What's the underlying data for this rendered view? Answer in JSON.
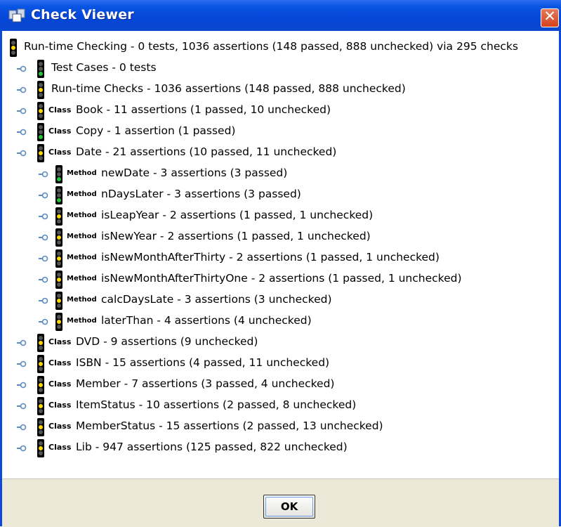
{
  "window": {
    "title": "Check Viewer",
    "close_symbol": "✕"
  },
  "tree": {
    "nodes": [
      {
        "label": "Run-time Checking - 0 tests, 1036 assertions (148 passed, 888 unchecked) via 295 checks",
        "kind": "",
        "status": "yellow",
        "level": 0
      },
      {
        "label": "Test Cases - 0 tests",
        "kind": "",
        "status": "green",
        "level": 1
      },
      {
        "label": "Run-time Checks - 1036 assertions (148 passed, 888 unchecked)",
        "kind": "",
        "status": "yellow",
        "level": 1
      },
      {
        "label": "Book - 11 assertions (1 passed, 10 unchecked)",
        "kind": "Class",
        "status": "yellow",
        "level": 2
      },
      {
        "label": "Copy - 1 assertion (1 passed)",
        "kind": "Class",
        "status": "green",
        "level": 2
      },
      {
        "label": "Date - 21 assertions (10 passed, 11 unchecked)",
        "kind": "Class",
        "status": "yellow",
        "level": 2
      },
      {
        "label": "newDate - 3 assertions (3 passed)",
        "kind": "Method",
        "status": "green",
        "level": 3
      },
      {
        "label": "nDaysLater - 3 assertions (3 passed)",
        "kind": "Method",
        "status": "green",
        "level": 3
      },
      {
        "label": "isLeapYear - 2 assertions (1 passed, 1 unchecked)",
        "kind": "Method",
        "status": "yellow",
        "level": 3
      },
      {
        "label": "isNewYear - 2 assertions (1 passed, 1 unchecked)",
        "kind": "Method",
        "status": "yellow",
        "level": 3
      },
      {
        "label": "isNewMonthAfterThirty - 2 assertions (1 passed, 1 unchecked)",
        "kind": "Method",
        "status": "yellow",
        "level": 3
      },
      {
        "label": "isNewMonthAfterThirtyOne - 2 assertions (1 passed, 1 unchecked)",
        "kind": "Method",
        "status": "yellow",
        "level": 3
      },
      {
        "label": "calcDaysLate - 3 assertions (3 unchecked)",
        "kind": "Method",
        "status": "yellow",
        "level": 3
      },
      {
        "label": "laterThan - 4 assertions (4 unchecked)",
        "kind": "Method",
        "status": "yellow",
        "level": 3
      },
      {
        "label": "DVD - 9 assertions (9 unchecked)",
        "kind": "Class",
        "status": "yellow",
        "level": 2
      },
      {
        "label": "ISBN - 15 assertions (4 passed, 11 unchecked)",
        "kind": "Class",
        "status": "yellow",
        "level": 2
      },
      {
        "label": "Member - 7 assertions (3 passed, 4 unchecked)",
        "kind": "Class",
        "status": "yellow",
        "level": 2
      },
      {
        "label": "ItemStatus - 10 assertions (2 passed, 8 unchecked)",
        "kind": "Class",
        "status": "yellow",
        "level": 2
      },
      {
        "label": "MemberStatus - 15 assertions (2 passed, 13 unchecked)",
        "kind": "Class",
        "status": "yellow",
        "level": 2
      },
      {
        "label": "Lib - 947 assertions (125 passed, 822 unchecked)",
        "kind": "Class",
        "status": "yellow",
        "level": 2
      }
    ]
  },
  "footer": {
    "ok_label": "OK"
  },
  "colors": {
    "title_bar": "#0546d7",
    "close_button": "#d4421c",
    "light_yellow": "#ffd800",
    "light_green": "#22c63a",
    "tree_handle": "#5a8bc0"
  },
  "icons": {
    "app": "app-icon",
    "close": "close-icon",
    "status": "traffic-light-icon",
    "expand": "tree-handle-icon"
  }
}
